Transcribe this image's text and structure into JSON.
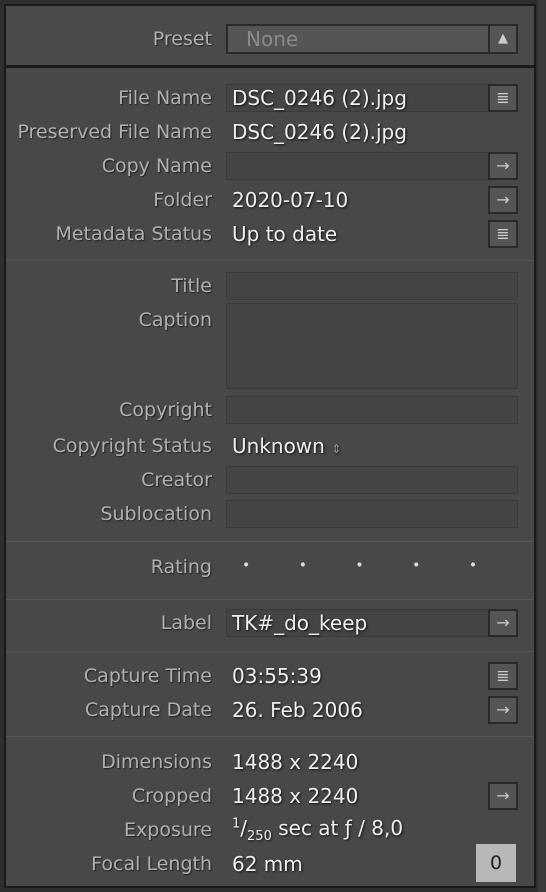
{
  "preset": {
    "label": "Preset",
    "value": "None"
  },
  "file": {
    "file_name": {
      "label": "File Name",
      "value": "DSC_0246 (2).jpg"
    },
    "preserved_file_name": {
      "label": "Preserved File Name",
      "value": "DSC_0246 (2).jpg"
    },
    "copy_name": {
      "label": "Copy Name",
      "value": ""
    },
    "folder": {
      "label": "Folder",
      "value": "2020-07-10"
    },
    "metadata_status": {
      "label": "Metadata Status",
      "value": "Up to date"
    }
  },
  "iptc": {
    "title": {
      "label": "Title",
      "value": ""
    },
    "caption": {
      "label": "Caption",
      "value": ""
    },
    "copyright": {
      "label": "Copyright",
      "value": ""
    },
    "copyright_status": {
      "label": "Copyright Status",
      "value": "Unknown"
    },
    "creator": {
      "label": "Creator",
      "value": ""
    },
    "sublocation": {
      "label": "Sublocation",
      "value": ""
    }
  },
  "rating": {
    "label": "Rating",
    "value": 0,
    "dots": "• • • • •"
  },
  "label": {
    "label": "Label",
    "value": "TK#_do_keep"
  },
  "capture": {
    "time": {
      "label": "Capture Time",
      "value": "03:55:39"
    },
    "date": {
      "label": "Capture Date",
      "value": "26. Feb 2006"
    }
  },
  "exif": {
    "dimensions": {
      "label": "Dimensions",
      "value": "1488 x 2240"
    },
    "cropped": {
      "label": "Cropped",
      "value": "1488 x 2240"
    },
    "exposure": {
      "label": "Exposure",
      "numerator": "1",
      "denominator": "250",
      "suffix": " sec at ƒ / 8,0"
    },
    "focal_length": {
      "label": "Focal Length",
      "value": "62 mm"
    }
  },
  "badge": "0",
  "icons": {
    "list": "≣",
    "arrow": "→",
    "spin": "⇕"
  }
}
